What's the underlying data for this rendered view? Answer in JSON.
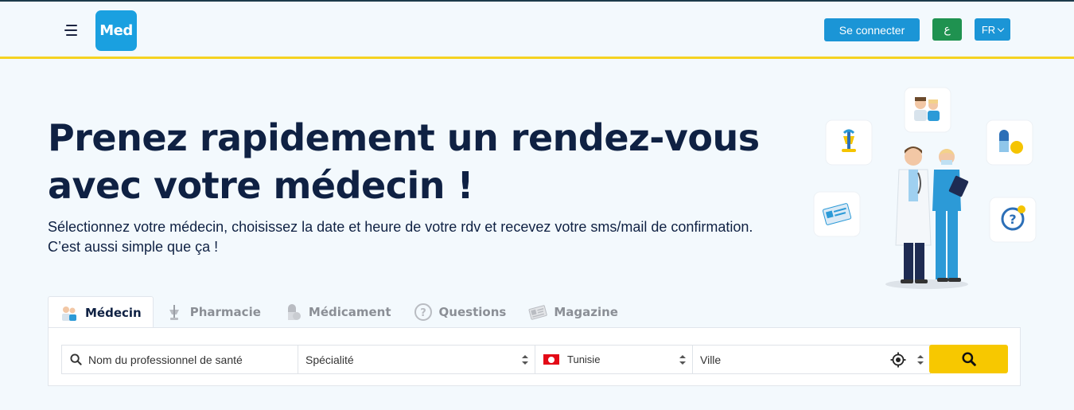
{
  "header": {
    "logo_text": "Med",
    "login_label": "Se connecter",
    "arabic_label": "ع",
    "lang_label": "FR",
    "colors": {
      "primary": "#1b95d6",
      "arabic_button": "#1f9250",
      "accent_line": "#f5d321"
    }
  },
  "hero": {
    "title": "Prenez rapidement un rendez-vous avec votre médecin !",
    "subtitle": "Sélectionnez votre médecin, choisissez la date et heure de votre rdv et recevez votre sms/mail de confirmation. C’est aussi simple que ça !"
  },
  "tabs": [
    {
      "label": "Médecin",
      "icon": "doctors-icon",
      "active": true
    },
    {
      "label": "Pharmacie",
      "icon": "pharmacy-icon",
      "active": false
    },
    {
      "label": "Médicament",
      "icon": "pill-icon",
      "active": false
    },
    {
      "label": "Questions",
      "icon": "question-icon",
      "active": false
    },
    {
      "label": "Magazine",
      "icon": "magazine-icon",
      "active": false
    }
  ],
  "search": {
    "name_placeholder": "Nom du professionnel de santé",
    "specialty_value": "Spécialité",
    "country_value": "Tunisie",
    "city_value": "Ville",
    "search_button_color": "#f7c800"
  }
}
